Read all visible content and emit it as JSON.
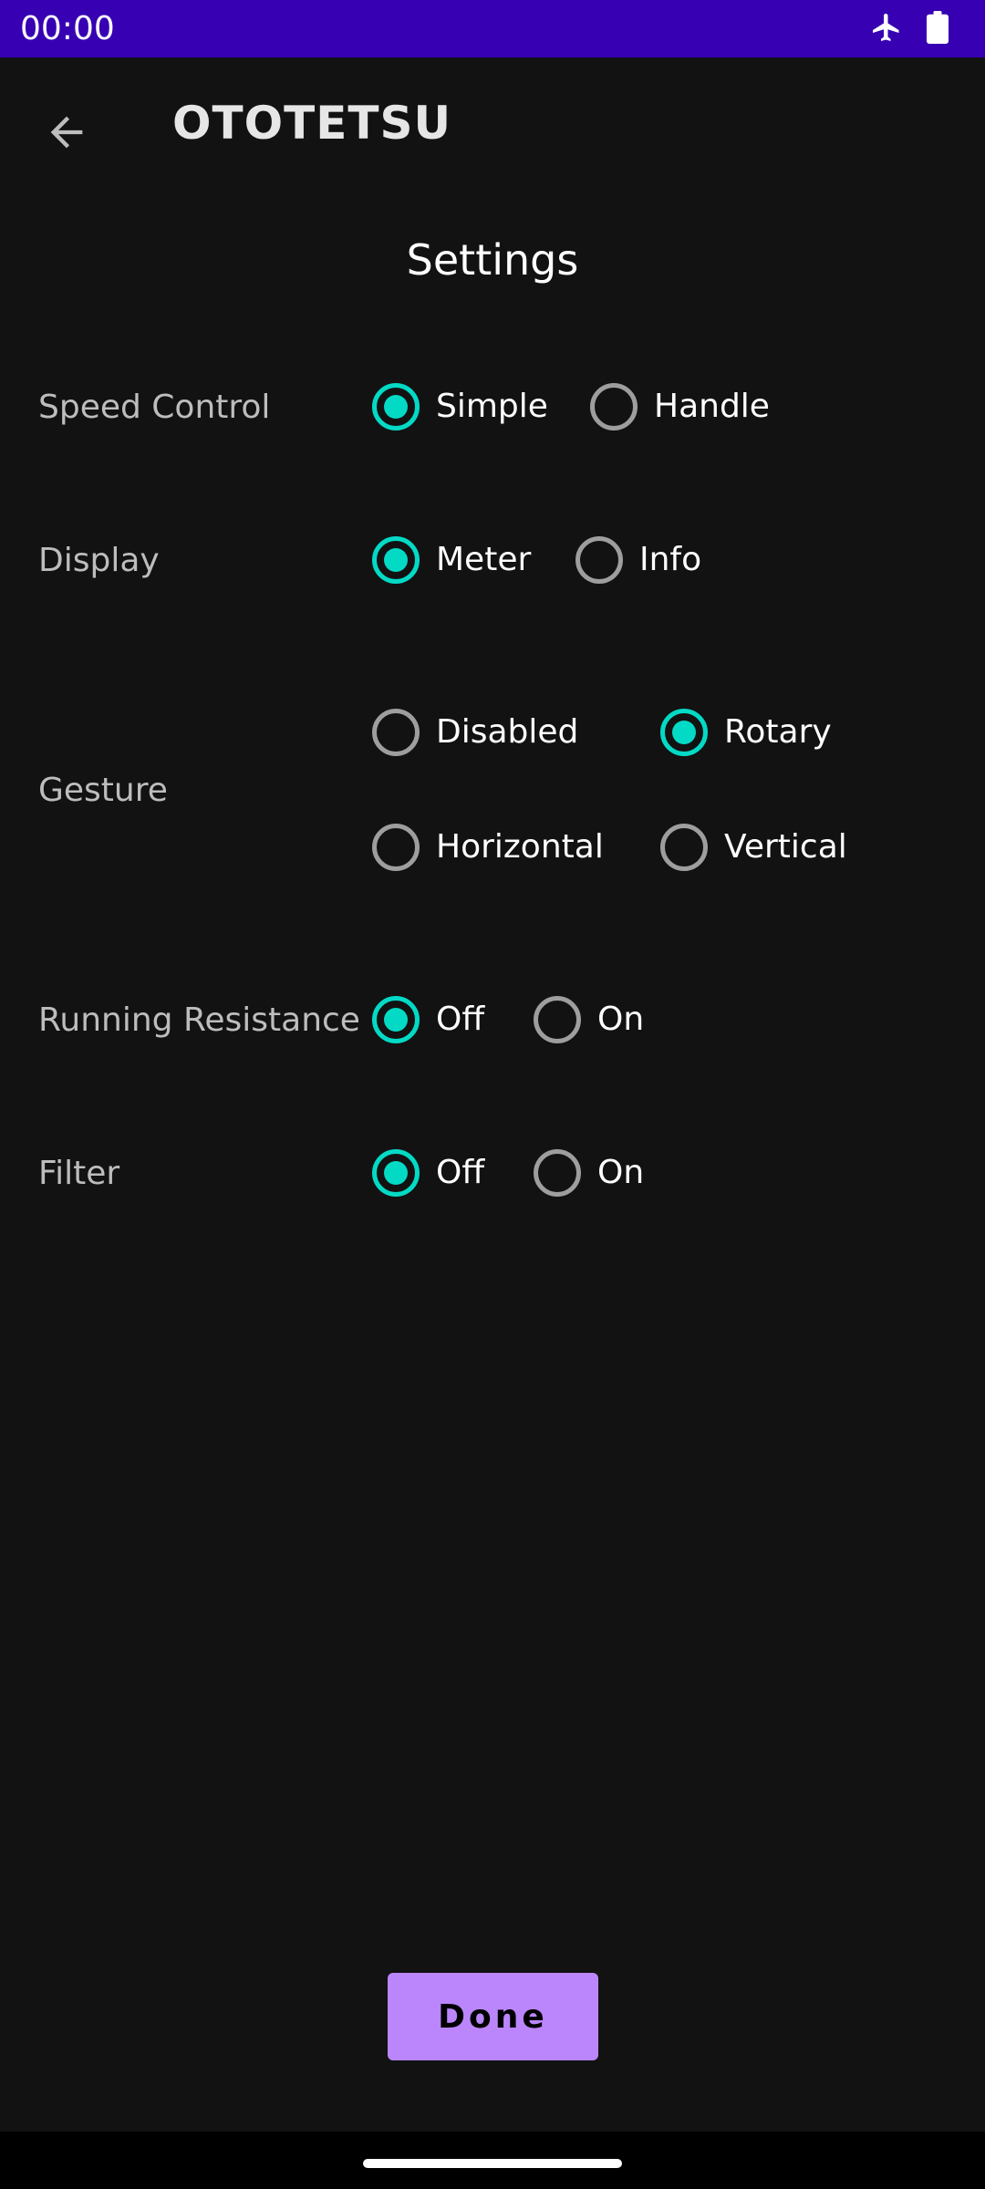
{
  "status_bar": {
    "time": "00:00",
    "icons": [
      "airplane-icon",
      "battery-icon"
    ],
    "color": "#3700b3"
  },
  "app_bar": {
    "back_icon": "arrow-back-icon",
    "title": "OTOTETSU"
  },
  "page": {
    "title": "Settings"
  },
  "settings": {
    "speed_control": {
      "label": "Speed Control",
      "options": [
        "Simple",
        "Handle"
      ],
      "selected": "Simple"
    },
    "display": {
      "label": "Display",
      "options": [
        "Meter",
        "Info"
      ],
      "selected": "Meter"
    },
    "gesture": {
      "label": "Gesture",
      "options": [
        "Disabled",
        "Rotary",
        "Horizontal",
        "Vertical"
      ],
      "selected": "Rotary"
    },
    "running_resistance": {
      "label": "Running Resistance",
      "options": [
        "Off",
        "On"
      ],
      "selected": "Off"
    },
    "filter": {
      "label": "Filter",
      "options": [
        "Off",
        "On"
      ],
      "selected": "Off"
    }
  },
  "actions": {
    "done_label": "Done"
  },
  "colors": {
    "accent": "#03dac5",
    "primary": "#bb86fc",
    "background": "#121212"
  }
}
